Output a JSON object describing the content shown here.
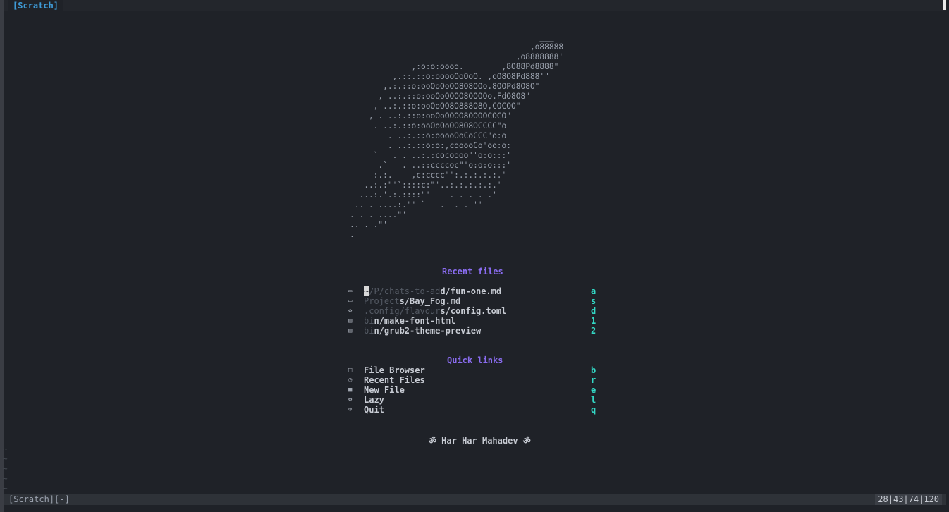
{
  "tabline": {
    "active_tab": "[Scratch]"
  },
  "ascii_art": "                                        ___\n                                      ,o88888\n                                   ,o8888888'\n             ,:o:o:oooo.        ,8O88Pd8888\"\n         ,.::.::o:ooooOoOoO. ,oO8O8Pd888'\"\n       ,.:.::o:ooOoOoOO8O8OOo.8OOPd8O8O\"\n      , ..:.::o:ooOoOOOO8OOOOo.FdO8O8\"\n     , ..:.::o:ooOoOO8O888O8O,COCOO\"\n    , . ..:.::o:ooOoOOOO8OOOOCOCO\"\n     . ..:.::o:ooOoOoOO8O8OCCCC\"o\n        . ..:.::o:ooooOoCoCCC\"o:o\n        . ..:.::o:o:,cooooCo\"oo:o:\n     `   . . ..:.:cocoooo\"'o:o:::'\n      .`   . ..::ccccoc\"'o:o:o:::'\n     :.:.    ,c:cccc\"':.:.:.:.:.'\n   ..:.:\"'`::::c:\"'..:.:.:.:.:.'\n  ...:.'.:.::::\"'    . . . . .'\n .. . ....:.\"' `   .  . . ''\n. . . ....\"'\n.. . .\"'\n.",
  "recent_files": {
    "title": "Recent files",
    "items": [
      {
        "icon": "markdown-icon",
        "glyph": "▭",
        "dim": "~/P/chats-to-ad",
        "bright": "d/fun-one.md",
        "key": "a"
      },
      {
        "icon": "markdown-icon",
        "glyph": "▭",
        "dim": "Project",
        "bright": "s/Bay_Fog.md",
        "key": "s"
      },
      {
        "icon": "gear-icon",
        "glyph": "✿",
        "dim": ".config/flavour",
        "bright": "s/config.toml",
        "key": "d"
      },
      {
        "icon": "file-icon",
        "glyph": "▤",
        "dim": "bi",
        "bright": "n/make-font-html",
        "key": "1"
      },
      {
        "icon": "file-icon",
        "glyph": "▤",
        "dim": "bi",
        "bright": "n/grub2-theme-preview",
        "key": "2"
      }
    ]
  },
  "quick_links": {
    "title": "Quick links",
    "items": [
      {
        "icon": "folder-icon",
        "glyph": "◰",
        "label": "File Browser",
        "key": "b"
      },
      {
        "icon": "clock-icon",
        "glyph": "◷",
        "label": "Recent Files",
        "key": "r"
      },
      {
        "icon": "new-file-icon",
        "glyph": "■",
        "label": "New File",
        "key": "e"
      },
      {
        "icon": "gear-icon",
        "glyph": "✿",
        "label": "Lazy",
        "key": "l"
      },
      {
        "icon": "quit-icon",
        "glyph": "⊗",
        "label": "Quit",
        "key": "q"
      }
    ]
  },
  "footer": {
    "text": "ॐ Har Har Mahadev ॐ"
  },
  "statusline": {
    "left": "[Scratch][-]",
    "right": "28|43|74|120"
  },
  "tildes": [
    "~",
    "~",
    "~",
    "~",
    "~"
  ],
  "colors": {
    "accent": "#8a6cf0",
    "key": "#33d9c6",
    "tab": "#3e9ad6",
    "background": "#1f2228"
  }
}
